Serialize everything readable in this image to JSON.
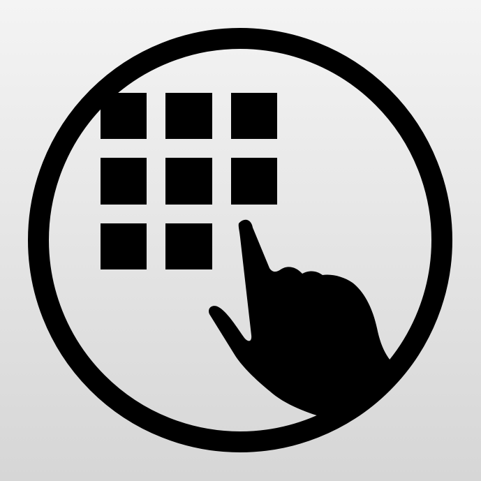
{
  "icon": {
    "name": "keypad-touch-app-icon",
    "glyphs": [
      "circle-ring-icon",
      "keypad-grid-icon",
      "pointing-hand-icon"
    ],
    "colors": {
      "foreground": "#000000",
      "background_top": "#f4f4f4",
      "background_bottom": "#d6d6d6"
    },
    "keypad": {
      "rows": 3,
      "columns": 3,
      "visible_keys": 8
    }
  }
}
